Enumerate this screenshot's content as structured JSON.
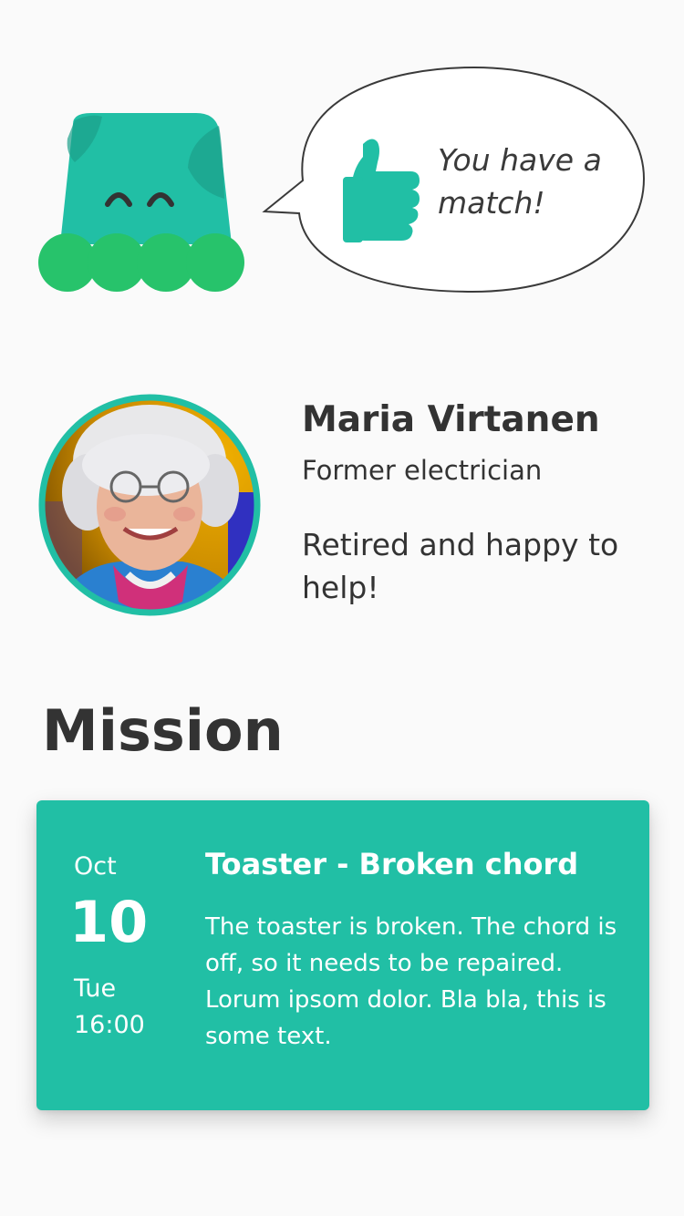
{
  "speech_bubble": {
    "text": "You have a match!",
    "icon": "thumbs-up-icon"
  },
  "mascot": {
    "icon": "mascot-character",
    "body_color": "#21bfa5",
    "feet_color": "#27c36b"
  },
  "profile": {
    "name": "Maria Virtanen",
    "role": "Former electrician",
    "bio": "Retired and happy to help!",
    "avatar_icon": "avatar-photo",
    "ring_color": "#21bfa5"
  },
  "mission": {
    "section_title": "Mission",
    "card": {
      "month": "Oct",
      "day": "10",
      "weekday": "Tue",
      "time": "16:00",
      "title": "Toaster - Broken chord",
      "description": "The toaster is broken. The chord is off, so it needs to be repaired. Lorum ipsom dolor. Bla bla, this  is some text.",
      "background_color": "#21bfa5"
    }
  },
  "colors": {
    "accent": "#21bfa5",
    "text": "#333333",
    "background": "#fafafa"
  }
}
